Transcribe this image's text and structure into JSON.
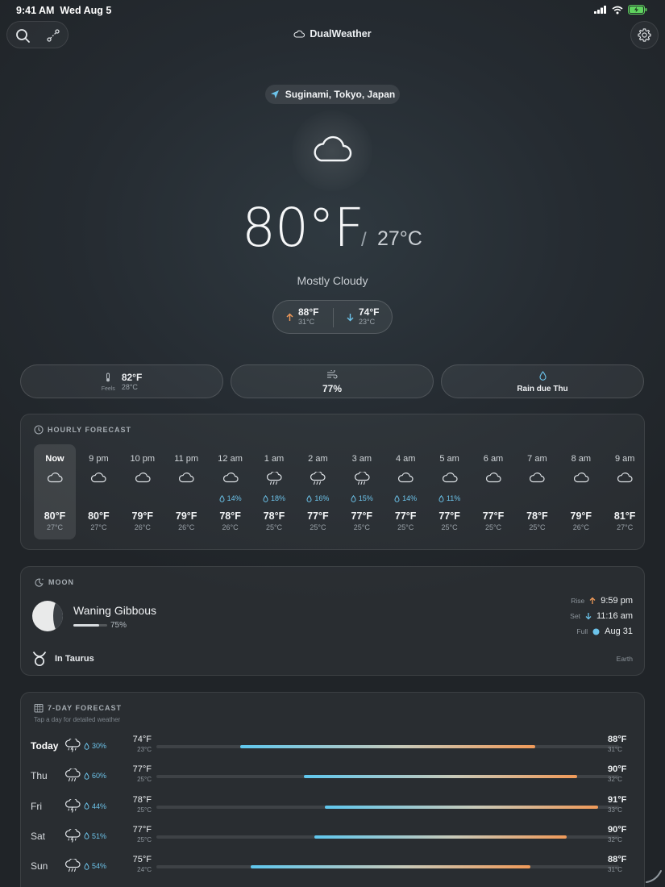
{
  "status_bar": {
    "time": "9:41 AM",
    "date": "Wed Aug 5"
  },
  "app": {
    "title": "DualWeather"
  },
  "location": "Suginami, Tokyo, Japan",
  "current": {
    "temp_f": "80°F",
    "separator": "/",
    "temp_c": "27°C",
    "condition": "Mostly Cloudy",
    "high_f": "88°F",
    "high_c": "31°C",
    "low_f": "74°F",
    "low_c": "23°C"
  },
  "stats": {
    "feels_label": "Feels",
    "feels_f": "82°F",
    "feels_c": "28°C",
    "humidity": "77%",
    "rain": "Rain due Thu"
  },
  "hourly": {
    "title": "HOURLY FORECAST",
    "hours": [
      {
        "label": "Now",
        "icon": "cloud",
        "pop": "",
        "f": "80°F",
        "c": "27°C"
      },
      {
        "label": "9 pm",
        "icon": "cloud",
        "pop": "",
        "f": "80°F",
        "c": "27°C"
      },
      {
        "label": "10 pm",
        "icon": "cloud",
        "pop": "",
        "f": "79°F",
        "c": "26°C"
      },
      {
        "label": "11 pm",
        "icon": "cloud",
        "pop": "",
        "f": "79°F",
        "c": "26°C"
      },
      {
        "label": "12 am",
        "icon": "cloud",
        "pop": "14%",
        "f": "78°F",
        "c": "26°C"
      },
      {
        "label": "1 am",
        "icon": "rain",
        "pop": "18%",
        "f": "78°F",
        "c": "25°C"
      },
      {
        "label": "2 am",
        "icon": "rain",
        "pop": "16%",
        "f": "77°F",
        "c": "25°C"
      },
      {
        "label": "3 am",
        "icon": "rain",
        "pop": "15%",
        "f": "77°F",
        "c": "25°C"
      },
      {
        "label": "4 am",
        "icon": "cloud",
        "pop": "14%",
        "f": "77°F",
        "c": "25°C"
      },
      {
        "label": "5 am",
        "icon": "cloud",
        "pop": "11%",
        "f": "77°F",
        "c": "25°C"
      },
      {
        "label": "6 am",
        "icon": "cloud",
        "pop": "",
        "f": "77°F",
        "c": "25°C"
      },
      {
        "label": "7 am",
        "icon": "cloud",
        "pop": "",
        "f": "78°F",
        "c": "25°C"
      },
      {
        "label": "8 am",
        "icon": "cloud",
        "pop": "",
        "f": "79°F",
        "c": "26°C"
      },
      {
        "label": "9 am",
        "icon": "cloud",
        "pop": "",
        "f": "81°F",
        "c": "27°C"
      }
    ]
  },
  "moon": {
    "title": "MOON",
    "phase": "Waning Gibbous",
    "illumination": "75%",
    "illumination_fraction": 0.75,
    "rise_label": "Rise",
    "rise": "9:59 pm",
    "set_label": "Set",
    "set": "11:16 am",
    "full_label": "Full",
    "full": "Aug 31",
    "constellation": "In Taurus",
    "reference": "Earth"
  },
  "week": {
    "title": "7-DAY FORECAST",
    "subtitle": "Tap a day for detailed weather",
    "scale_min_f": 70,
    "scale_max_f": 92,
    "days": [
      {
        "name": "Today",
        "icon": "thunderstorm",
        "pop": "30%",
        "lo_f": "74°F",
        "lo_c": "23°C",
        "hi_f": "88°F",
        "hi_c": "31°C",
        "lo": 74,
        "hi": 88
      },
      {
        "name": "Thu",
        "icon": "rain",
        "pop": "60%",
        "lo_f": "77°F",
        "lo_c": "25°C",
        "hi_f": "90°F",
        "hi_c": "32°C",
        "lo": 77,
        "hi": 90
      },
      {
        "name": "Fri",
        "icon": "thunderstorm",
        "pop": "44%",
        "lo_f": "78°F",
        "lo_c": "25°C",
        "hi_f": "91°F",
        "hi_c": "33°C",
        "lo": 78,
        "hi": 91
      },
      {
        "name": "Sat",
        "icon": "thunderstorm",
        "pop": "51%",
        "lo_f": "77°F",
        "lo_c": "25°C",
        "hi_f": "90°F",
        "hi_c": "32°C",
        "lo": 77.5,
        "hi": 89.5
      },
      {
        "name": "Sun",
        "icon": "rain",
        "pop": "54%",
        "lo_f": "75°F",
        "lo_c": "24°C",
        "hi_f": "88°F",
        "hi_c": "31°C",
        "lo": 74.5,
        "hi": 87.8
      }
    ]
  },
  "colors": {
    "accent_blue": "#6cc3ea",
    "accent_orange": "#f09a59",
    "background": "#252b31"
  }
}
